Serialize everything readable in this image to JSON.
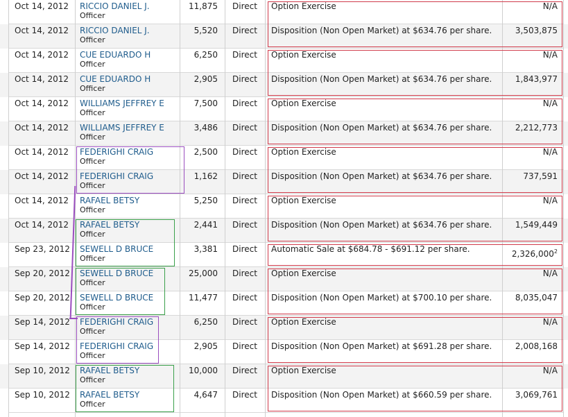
{
  "colors": {
    "red_box": "#d03a4a",
    "purple_box": "#9a4dbf",
    "green_box": "#3aa04a",
    "link": "#1f5c8c"
  },
  "rows": [
    {
      "date": "Oct 14, 2012",
      "name": "RICCIO DANIEL J.",
      "role": "Officer",
      "shares": "11,875",
      "ownership": "Direct",
      "description": "Option Exercise",
      "value": "N/A"
    },
    {
      "date": "Oct 14, 2012",
      "name": "RICCIO DANIEL J.",
      "role": "Officer",
      "shares": "5,520",
      "ownership": "Direct",
      "description": "Disposition (Non Open Market) at $634.76 per share.",
      "value": "3,503,875"
    },
    {
      "date": "Oct 14, 2012",
      "name": "CUE EDUARDO H",
      "role": "Officer",
      "shares": "6,250",
      "ownership": "Direct",
      "description": "Option Exercise",
      "value": "N/A"
    },
    {
      "date": "Oct 14, 2012",
      "name": "CUE EDUARDO H",
      "role": "Officer",
      "shares": "2,905",
      "ownership": "Direct",
      "description": "Disposition (Non Open Market) at $634.76 per share.",
      "value": "1,843,977"
    },
    {
      "date": "Oct 14, 2012",
      "name": "WILLIAMS JEFFREY E",
      "role": "Officer",
      "shares": "7,500",
      "ownership": "Direct",
      "description": "Option Exercise",
      "value": "N/A"
    },
    {
      "date": "Oct 14, 2012",
      "name": "WILLIAMS JEFFREY E",
      "role": "Officer",
      "shares": "3,486",
      "ownership": "Direct",
      "description": "Disposition (Non Open Market) at $634.76 per share.",
      "value": "2,212,773"
    },
    {
      "date": "Oct 14, 2012",
      "name": "FEDERIGHI CRAIG",
      "role": "Officer",
      "shares": "2,500",
      "ownership": "Direct",
      "description": "Option Exercise",
      "value": "N/A"
    },
    {
      "date": "Oct 14, 2012",
      "name": "FEDERIGHI CRAIG",
      "role": "Officer",
      "shares": "1,162",
      "ownership": "Direct",
      "description": "Disposition (Non Open Market) at $634.76 per share.",
      "value": "737,591"
    },
    {
      "date": "Oct 14, 2012",
      "name": "RAFAEL BETSY",
      "role": "Officer",
      "shares": "5,250",
      "ownership": "Direct",
      "description": "Option Exercise",
      "value": "N/A"
    },
    {
      "date": "Oct 14, 2012",
      "name": "RAFAEL BETSY",
      "role": "Officer",
      "shares": "2,441",
      "ownership": "Direct",
      "description": "Disposition (Non Open Market) at $634.76 per share.",
      "value": "1,549,449"
    },
    {
      "date": "Sep 23, 2012",
      "name": "SEWELL D BRUCE",
      "role": "Officer",
      "shares": "3,381",
      "ownership": "Direct",
      "description": "Automatic Sale at $684.78 - $691.12 per share.",
      "value": "2,326,000",
      "footnote": "2"
    },
    {
      "date": "Sep 20, 2012",
      "name": "SEWELL D BRUCE",
      "role": "Officer",
      "shares": "25,000",
      "ownership": "Direct",
      "description": "Option Exercise",
      "value": "N/A"
    },
    {
      "date": "Sep 20, 2012",
      "name": "SEWELL D BRUCE",
      "role": "Officer",
      "shares": "11,477",
      "ownership": "Direct",
      "description": "Disposition (Non Open Market) at $700.10 per share.",
      "value": "8,035,047"
    },
    {
      "date": "Sep 14, 2012",
      "name": "FEDERIGHI CRAIG",
      "role": "Officer",
      "shares": "6,250",
      "ownership": "Direct",
      "description": "Option Exercise",
      "value": "N/A"
    },
    {
      "date": "Sep 14, 2012",
      "name": "FEDERIGHI CRAIG",
      "role": "Officer",
      "shares": "2,905",
      "ownership": "Direct",
      "description": "Disposition (Non Open Market) at $691.28 per share.",
      "value": "2,008,168"
    },
    {
      "date": "Sep 10, 2012",
      "name": "RAFAEL BETSY",
      "role": "Officer",
      "shares": "10,000",
      "ownership": "Direct",
      "description": "Option Exercise",
      "value": "N/A"
    },
    {
      "date": "Sep 10, 2012",
      "name": "RAFAEL BETSY",
      "role": "Officer",
      "shares": "4,647",
      "ownership": "Direct",
      "description": "Disposition (Non Open Market) at $660.59 per share.",
      "value": "3,069,761"
    }
  ]
}
